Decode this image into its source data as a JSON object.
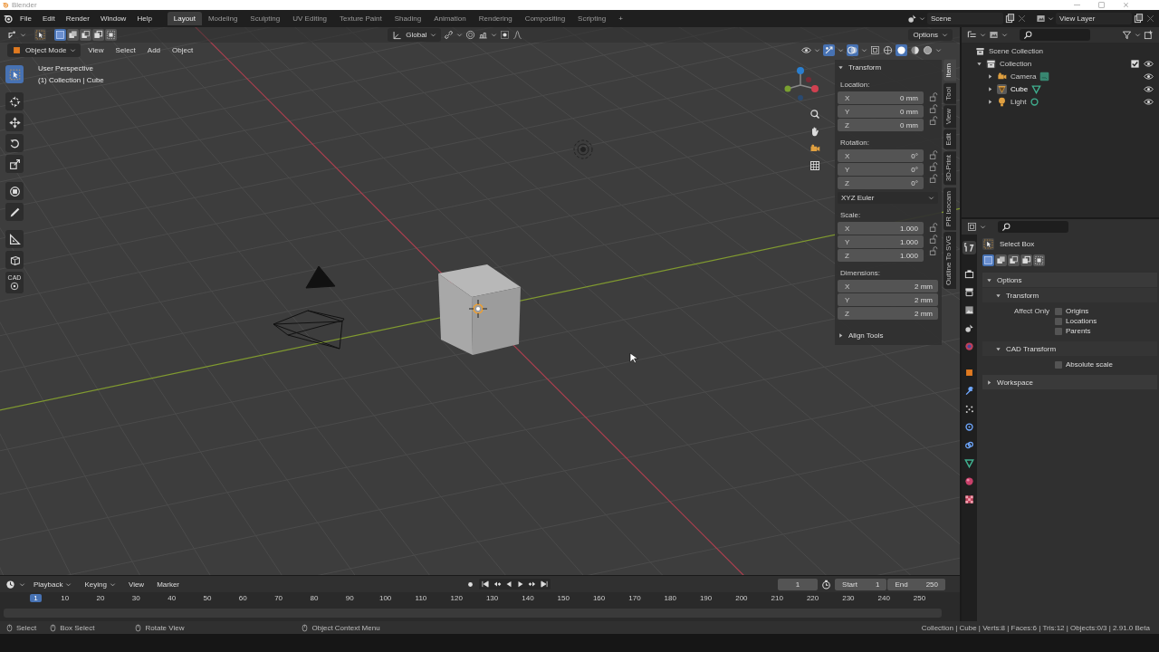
{
  "window": {
    "title": "Blender"
  },
  "menus": [
    "File",
    "Edit",
    "Render",
    "Window",
    "Help"
  ],
  "workspaces": [
    {
      "label": "Layout",
      "selected": true
    },
    {
      "label": "Modeling",
      "selected": false
    },
    {
      "label": "Sculpting",
      "selected": false
    },
    {
      "label": "UV Editing",
      "selected": false
    },
    {
      "label": "Texture Paint",
      "selected": false
    },
    {
      "label": "Shading",
      "selected": false
    },
    {
      "label": "Animation",
      "selected": false
    },
    {
      "label": "Rendering",
      "selected": false
    },
    {
      "label": "Compositing",
      "selected": false
    },
    {
      "label": "Scripting",
      "selected": false
    }
  ],
  "add_workspace": "+",
  "scene": {
    "name": "Scene",
    "view_layer": "View Layer"
  },
  "tool_header": {
    "select_modes": [
      {
        "kind": "set",
        "selected": true
      },
      {
        "kind": "extend",
        "selected": false
      },
      {
        "kind": "subtract",
        "selected": false
      },
      {
        "kind": "difference",
        "selected": false
      },
      {
        "kind": "intersect",
        "selected": false
      }
    ],
    "orientation": "Global",
    "options": "Options"
  },
  "viewport_header": {
    "mode": "Object Mode",
    "menus": [
      "View",
      "Select",
      "Add",
      "Object"
    ]
  },
  "viewport": {
    "perspective": "User Perspective",
    "context": "(1) Collection | Cube"
  },
  "toolbar": [
    {
      "kind": "select",
      "selected": true
    },
    {
      "kind": "cursor",
      "selected": false
    },
    {
      "kind": "move",
      "selected": false
    },
    {
      "kind": "rotate",
      "selected": false
    },
    {
      "kind": "scale",
      "selected": false
    },
    {
      "kind": "transform",
      "selected": false
    },
    {
      "kind": "annotate",
      "selected": false
    },
    {
      "kind": "measure",
      "selected": false
    },
    {
      "kind": "add-cube",
      "selected": false
    },
    {
      "kind": "cad",
      "selected": false,
      "label": "CAD"
    }
  ],
  "sidebar": {
    "title": "Transform",
    "expanded": true,
    "groups": [
      {
        "label": "Location:",
        "lock_icons": true,
        "rows": [
          {
            "axis": "X",
            "value": "0 mm"
          },
          {
            "axis": "Y",
            "value": "0 mm"
          },
          {
            "axis": "Z",
            "value": "0 mm"
          }
        ]
      },
      {
        "label": "Rotation:",
        "lock_icons": true,
        "rows": [
          {
            "axis": "X",
            "value": "0°"
          },
          {
            "axis": "Y",
            "value": "0°"
          },
          {
            "axis": "Z",
            "value": "0°"
          }
        ],
        "mode": "XYZ Euler"
      },
      {
        "label": "Scale:",
        "lock_icons": true,
        "rows": [
          {
            "axis": "X",
            "value": "1.000"
          },
          {
            "axis": "Y",
            "value": "1.000"
          },
          {
            "axis": "Z",
            "value": "1.000"
          }
        ]
      },
      {
        "label": "Dimensions:",
        "lock_icons": false,
        "rows": [
          {
            "axis": "X",
            "value": "2 mm"
          },
          {
            "axis": "Y",
            "value": "2 mm"
          },
          {
            "axis": "Z",
            "value": "2 mm"
          }
        ]
      }
    ],
    "collapsed_panel": {
      "title": "Align Tools",
      "expanded": false
    },
    "tabs": [
      {
        "label": "Item",
        "selected": true
      },
      {
        "label": "Tool",
        "selected": false
      },
      {
        "label": "View",
        "selected": false
      },
      {
        "label": "Edit",
        "selected": false
      },
      {
        "label": "3D-Print",
        "selected": false
      },
      {
        "label": "PR Isocam",
        "selected": false
      },
      {
        "label": "Outline To SVG",
        "selected": false
      }
    ]
  },
  "outliner": {
    "tree": [
      {
        "label": "Scene Collection",
        "kind": "scene",
        "children": [
          {
            "label": "Collection",
            "kind": "collection",
            "expanded": true,
            "checked": true,
            "children": [
              {
                "label": "Camera",
                "kind": "camera",
                "expanded": false,
                "selected": false
              },
              {
                "label": "Cube",
                "kind": "mesh",
                "expanded": false,
                "selected": true
              },
              {
                "label": "Light",
                "kind": "light",
                "expanded": false,
                "selected": false
              }
            ]
          }
        ]
      }
    ]
  },
  "properties": {
    "tabs": [
      {
        "kind": "tool",
        "selected": true
      },
      {
        "kind": "render",
        "selected": false
      },
      {
        "kind": "output",
        "selected": false
      },
      {
        "kind": "view-layer",
        "selected": false
      },
      {
        "kind": "scene",
        "selected": false
      },
      {
        "kind": "world",
        "selected": false
      },
      {
        "kind": "object",
        "selected": false
      },
      {
        "kind": "modifier",
        "selected": false
      },
      {
        "kind": "particles",
        "selected": false
      },
      {
        "kind": "physics",
        "selected": false
      },
      {
        "kind": "constraints",
        "selected": false
      },
      {
        "kind": "data",
        "selected": false
      },
      {
        "kind": "material",
        "selected": false
      },
      {
        "kind": "texture",
        "selected": false
      }
    ],
    "tool": "Select Box",
    "select_modes": [
      {
        "kind": "set",
        "selected": true
      },
      {
        "kind": "extend",
        "selected": false
      },
      {
        "kind": "subtract",
        "selected": false
      },
      {
        "kind": "difference",
        "selected": false
      },
      {
        "kind": "intersect",
        "selected": false
      }
    ],
    "panels": [
      {
        "title": "Options",
        "expanded": true,
        "children": [
          {
            "title": "Transform",
            "expanded": true,
            "label": "Affect Only",
            "options": [
              {
                "label": "Origins",
                "checked": false
              },
              {
                "label": "Locations",
                "checked": false
              },
              {
                "label": "Parents",
                "checked": false
              }
            ]
          },
          {
            "title": "CAD Transform",
            "expanded": true,
            "options": [
              {
                "label": "Absolute scale",
                "checked": false
              }
            ]
          }
        ]
      },
      {
        "title": "Workspace",
        "expanded": false
      }
    ]
  },
  "timeline": {
    "menus": [
      "Playback",
      "Keying",
      "View",
      "Marker"
    ],
    "current_frame": "1",
    "start_label": "Start",
    "start": "1",
    "end_label": "End",
    "end": "250",
    "playhead": "1",
    "ruler": [
      "10",
      "20",
      "30",
      "40",
      "50",
      "60",
      "70",
      "80",
      "90",
      "100",
      "110",
      "120",
      "130",
      "140",
      "150",
      "160",
      "170",
      "180",
      "190",
      "200",
      "210",
      "220",
      "230",
      "240",
      "250"
    ]
  },
  "status_bar": {
    "hints": [
      {
        "kind": "left-click",
        "label": "Select"
      },
      {
        "kind": "drag",
        "label": "Box Select"
      },
      {
        "kind": "middle-click",
        "label": "Rotate View"
      },
      {
        "kind": "right-click",
        "label": "Object Context Menu"
      }
    ],
    "stats": "Collection | Cube | Verts:8 | Faces:6 | Tris:12 | Objects:0/3 | 2.91.0 Beta"
  }
}
